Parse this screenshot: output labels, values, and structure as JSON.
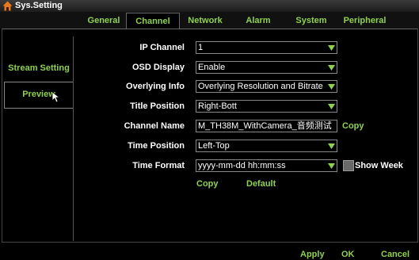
{
  "window": {
    "title": "Sys.Setting"
  },
  "tabs": [
    {
      "label": "General"
    },
    {
      "label": "Channel"
    },
    {
      "label": "Network"
    },
    {
      "label": "Alarm"
    },
    {
      "label": "System"
    },
    {
      "label": "Peripheral"
    }
  ],
  "sidebar": {
    "items": [
      {
        "label": "Stream Setting"
      },
      {
        "label": "Preview"
      }
    ]
  },
  "form": {
    "ip_channel": {
      "label": "IP Channel",
      "value": "1"
    },
    "osd_display": {
      "label": "OSD Display",
      "value": "Enable"
    },
    "overlying_info": {
      "label": "Overlying Info",
      "value": "Overlying Resolution and Bitrate"
    },
    "title_position": {
      "label": "Title Position",
      "value": "Right-Bott"
    },
    "channel_name": {
      "label": "Channel Name",
      "value": "M_TH38M_WithCamera_音频测试"
    },
    "time_position": {
      "label": "Time Position",
      "value": "Left-Top"
    },
    "time_format": {
      "label": "Time Format",
      "value": "yyyy-mm-dd hh:mm:ss"
    },
    "show_week": {
      "label": "Show Week",
      "checked": false
    },
    "channel_copy_label": "Copy",
    "copy_label": "Copy",
    "default_label": "Default"
  },
  "footer": {
    "apply": "Apply",
    "ok": "OK",
    "cancel": "Cancel"
  },
  "colors": {
    "accent": "#8fd14f",
    "background": "#000000"
  },
  "icons": {
    "title": "home-icon",
    "dropdown": "triangle-down-icon",
    "pointer": "mouse-cursor-icon"
  }
}
